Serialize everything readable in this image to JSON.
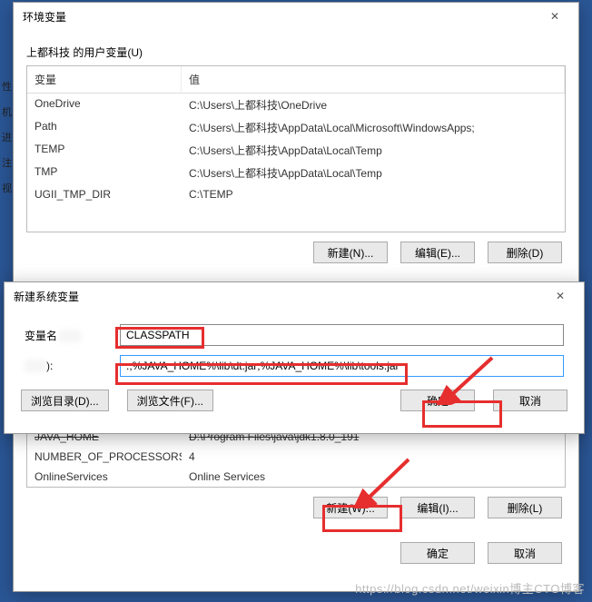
{
  "leftPanel": [
    "性",
    "机",
    "进",
    "注",
    "视"
  ],
  "envWin": {
    "title": "环境变量",
    "userSectionLabel": "上都科技 的用户变量(U)",
    "headers": {
      "var": "变量",
      "val": "值"
    },
    "userVars": [
      {
        "name": "OneDrive",
        "value": "C:\\Users\\上都科技\\OneDrive"
      },
      {
        "name": "Path",
        "value": "C:\\Users\\上都科技\\AppData\\Local\\Microsoft\\WindowsApps;"
      },
      {
        "name": "TEMP",
        "value": "C:\\Users\\上都科技\\AppData\\Local\\Temp"
      },
      {
        "name": "TMP",
        "value": "C:\\Users\\上都科技\\AppData\\Local\\Temp"
      },
      {
        "name": "UGII_TMP_DIR",
        "value": "C:\\TEMP"
      }
    ],
    "sysVarsHiddenRow": {
      "name": "JAVA_HOME",
      "value": "D:\\Program Files\\java\\jdk1.8.0_191"
    },
    "sysVars": [
      {
        "name": "NUMBER_OF_PROCESSORS",
        "value": "4"
      },
      {
        "name": "OnlineServices",
        "value": "Online Services"
      }
    ],
    "btns": {
      "newU": "新建(N)...",
      "editU": "编辑(E)...",
      "delU": "删除(D)",
      "newS": "新建(W)...",
      "editS": "编辑(I)...",
      "delS": "删除(L)",
      "ok": "确定",
      "cancel": "取消"
    }
  },
  "newVarWin": {
    "title": "新建系统变量",
    "nameLabel": "变量名",
    "valueLabel": "):",
    "nameValue": "CLASSPATH",
    "valueValue": ".;%JAVA_HOME%\\lib\\dt.jar;%JAVA_HOME%\\lib\\tools.jar",
    "browseDir": "浏览目录(D)...",
    "browseFile": "浏览文件(F)...",
    "ok": "确定",
    "cancel": "取消"
  },
  "watermark": "https://blog.csdn.net/weixin博主CTO博客"
}
